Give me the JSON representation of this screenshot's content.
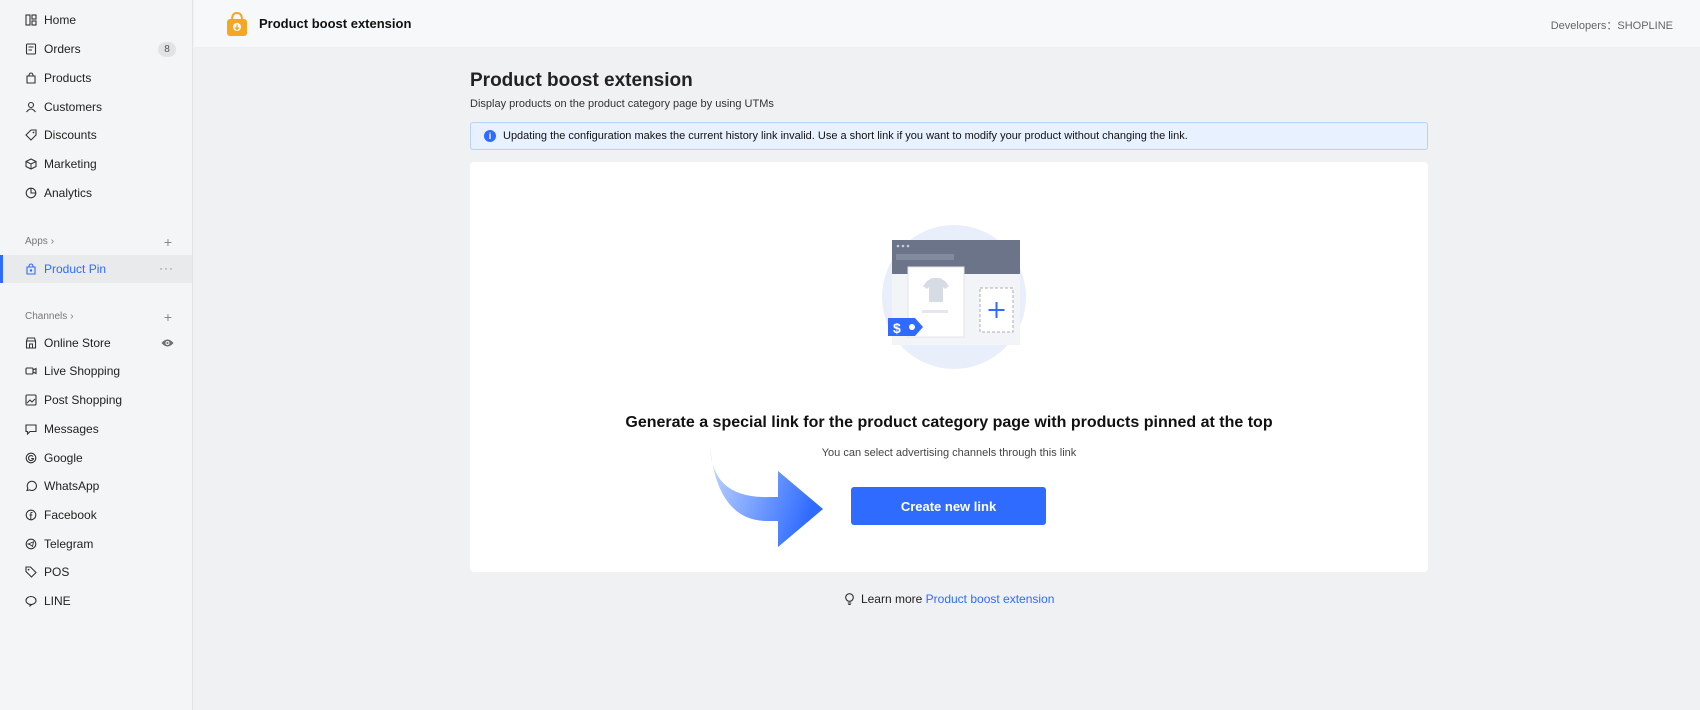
{
  "sidebar": {
    "main_items": [
      {
        "label": "Home",
        "icon": "home-icon"
      },
      {
        "label": "Orders",
        "icon": "orders-icon",
        "badge": "8"
      },
      {
        "label": "Products",
        "icon": "products-icon"
      },
      {
        "label": "Customers",
        "icon": "customers-icon"
      },
      {
        "label": "Discounts",
        "icon": "discounts-icon"
      },
      {
        "label": "Marketing",
        "icon": "marketing-icon"
      },
      {
        "label": "Analytics",
        "icon": "analytics-icon"
      }
    ],
    "apps_header": "Apps",
    "apps_items": [
      {
        "label": "Product Pin",
        "icon": "product-pin-icon",
        "active": true
      }
    ],
    "channels_header": "Channels",
    "channel_items": [
      {
        "label": "Online Store",
        "icon": "store-icon"
      },
      {
        "label": "Live Shopping",
        "icon": "video-icon"
      },
      {
        "label": "Post Shopping",
        "icon": "post-icon"
      },
      {
        "label": "Messages",
        "icon": "messages-icon"
      },
      {
        "label": "Google",
        "icon": "google-icon"
      },
      {
        "label": "WhatsApp",
        "icon": "whatsapp-icon"
      },
      {
        "label": "Facebook",
        "icon": "facebook-icon"
      },
      {
        "label": "Telegram",
        "icon": "telegram-icon"
      },
      {
        "label": "POS",
        "icon": "pos-icon"
      },
      {
        "label": "LINE",
        "icon": "line-icon"
      }
    ]
  },
  "topbar": {
    "app_title": "Product boost extension",
    "developer": "Developers：SHOPLINE"
  },
  "main": {
    "title": "Product boost extension",
    "subtitle": "Display products on the product category page by using UTMs",
    "alert": "Updating the configuration makes the current history link invalid. Use a short link if you want to modify your product without changing the link.",
    "headline": "Generate a special link for the product category page with products pinned at the top",
    "subline": "You can select advertising channels through this link",
    "create_button": "Create new link",
    "learn_more_prefix": "Learn more",
    "learn_more_link": "Product boost extension"
  },
  "colors": {
    "accent": "#2f6bff",
    "alert_bg": "#e8f1ff",
    "logo": "#f5a623"
  }
}
